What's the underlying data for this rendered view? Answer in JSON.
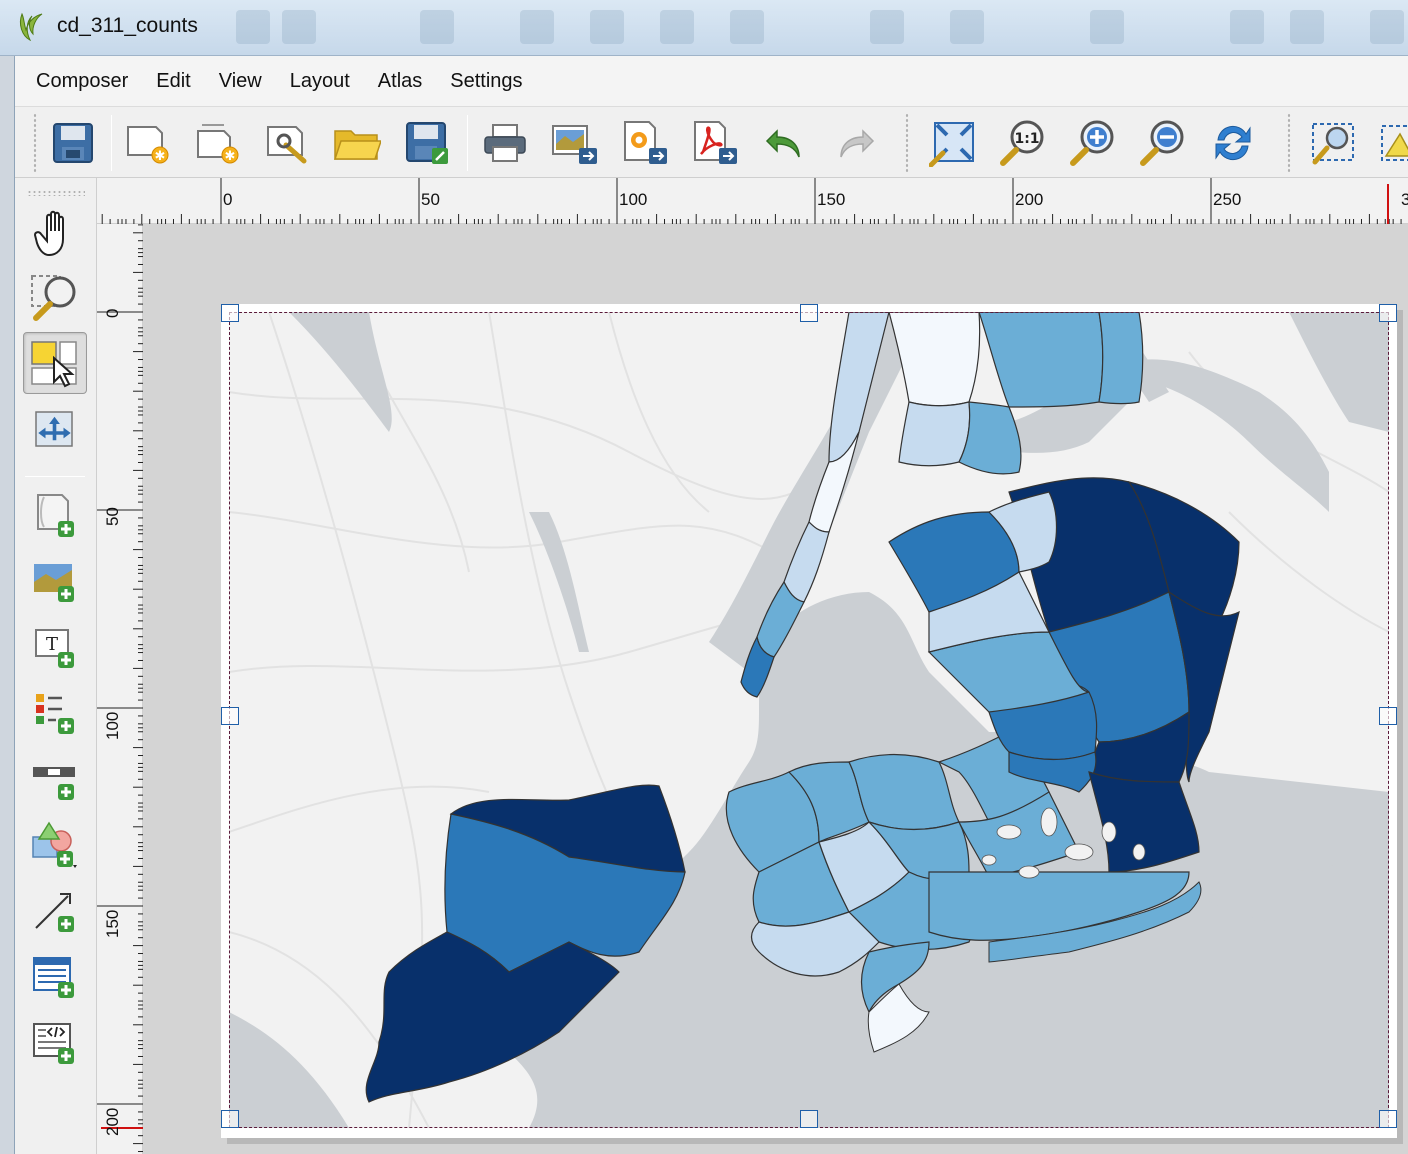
{
  "window": {
    "title": "cd_311_counts"
  },
  "menu": [
    "Composer",
    "Edit",
    "View",
    "Layout",
    "Atlas",
    "Settings"
  ],
  "toolbar_icons": [
    "save-icon",
    "new-composer-icon",
    "duplicate-composer-icon",
    "composer-manager-icon",
    "open-template-icon",
    "save-as-template-icon",
    "print-icon",
    "export-image-icon",
    "export-svg-icon",
    "export-pdf-icon",
    "undo-icon",
    "redo-icon",
    "zoom-full-icon",
    "zoom-actual-icon",
    "zoom-in-icon",
    "zoom-out-icon",
    "refresh-icon",
    "select-item-icon",
    "move-content-icon"
  ],
  "side_tools": [
    "pan-tool-icon",
    "zoom-tool-icon",
    "select-move-item-icon",
    "move-item-content-icon",
    "add-new-map-icon",
    "add-image-icon",
    "add-label-icon",
    "add-legend-icon",
    "add-scalebar-icon",
    "add-shape-icon",
    "add-arrow-icon",
    "add-attribute-table-icon",
    "add-html-frame-icon"
  ],
  "ruler": {
    "horizontal": [
      "0",
      "50",
      "100",
      "150",
      "200",
      "250",
      "3"
    ],
    "vertical": [
      "0",
      "50",
      "100",
      "150",
      "200"
    ]
  },
  "colors": {
    "choropleth_darkest": "#08306b",
    "choropleth_dark": "#2b78b8",
    "choropleth_mid": "#6baed6",
    "choropleth_light": "#c6dbef",
    "choropleth_lightest": "#f3f8fd",
    "water": "#cbcfd3",
    "land": "#f2f2f2"
  }
}
